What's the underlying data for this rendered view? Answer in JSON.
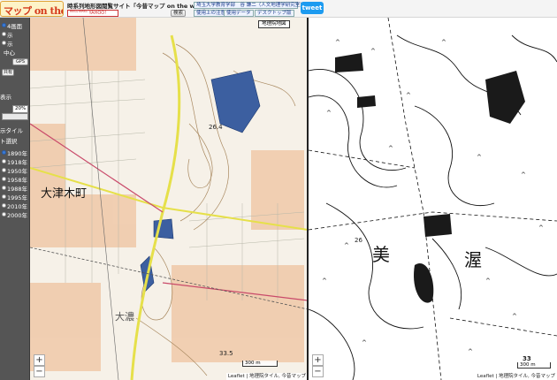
{
  "header": {
    "logo_text": "マップ on the web",
    "site_title": "時系列地形図閲覧サイト「今昔マップ on the web」",
    "yahoo_badge": "ᴿᴱᴳᴵˢᵀᴱᴿᴱᴰ YAHOO!",
    "search_button": "検索",
    "credit_link": "埼玉大学教育学部　谷 謙二（人文地理学研究室）",
    "notes_link": "使用上の注意",
    "data_link": "使用データ",
    "desktop_link": "デスクトップ版",
    "tweet_label": "tweet"
  },
  "sidebar": {
    "screen_mode": "4画面",
    "item_2": "示",
    "item_3": "示",
    "center_label": "中心",
    "gps_button": "GPS",
    "share_button": "共有",
    "display_label": "表示",
    "opacity_value": "20%",
    "tile_label": "示タイル",
    "select_label": "ト選択",
    "years": [
      "1890年",
      "1918年",
      "1950年",
      "1958年",
      "1988年",
      "1995年",
      "2010年",
      "2000年"
    ]
  },
  "left_map": {
    "layer_label": "地理院地図",
    "place_label": "大津木町",
    "place_label_2": "大濃",
    "spot_height_1": "33.5",
    "spot_height_2": "26.4",
    "scale_label": "300 m",
    "attribution": "Leaflet | 地理院タイル, 今昔マップ",
    "zoom_in": "+",
    "zoom_out": "−"
  },
  "right_map": {
    "place_label_1": "美",
    "place_label_2": "渥",
    "spot_height_1": "26",
    "spot_height_2": "33",
    "scale_label": "300 m",
    "attribution": "Leaflet | 地理院タイル, 今昔マップ",
    "zoom_in": "+",
    "zoom_out": "−"
  },
  "colors": {
    "sidebar_bg": "#555555",
    "tweet_bg": "#1d9bf0",
    "water_fill": "#3c5fa0",
    "road_yellow": "#e6e04a",
    "railway_pink": "#c94a6a"
  }
}
